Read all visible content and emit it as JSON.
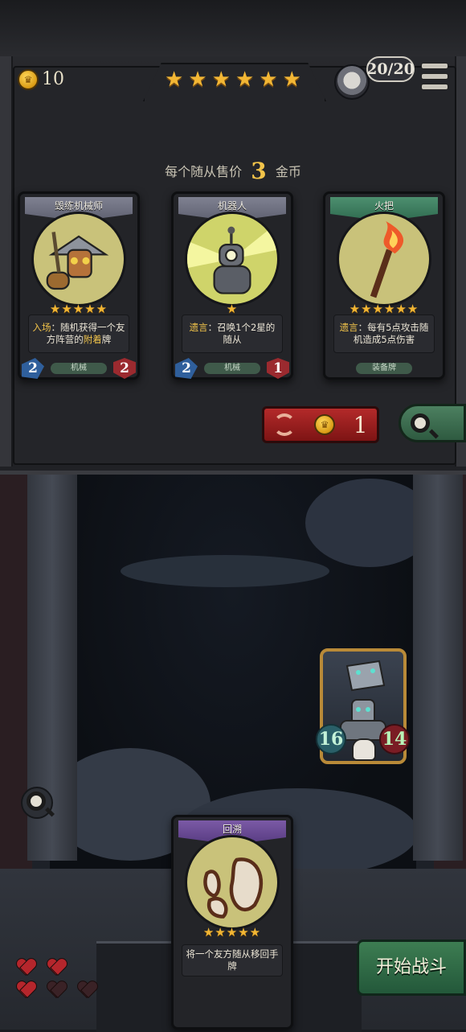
{
  "hud": {
    "gold": "10",
    "tier_stars": "★★★★★★",
    "player_health": "20/20"
  },
  "shop": {
    "price_prefix": "每个随从售价",
    "price_value": "3",
    "price_suffix": "金币",
    "refresh_cost": "1",
    "cards": [
      {
        "name": "毁练机械师",
        "stars": "★★★★★",
        "desc_kw": "入场",
        "desc_a": "：随机获得一个友方阵营的",
        "desc_kw2": "附着",
        "desc_b": "牌",
        "tribe": "机械",
        "attack": "2",
        "health": "2"
      },
      {
        "name": "机器人",
        "stars": "★",
        "desc_kw": "遗言",
        "desc_a": "：召唤1个2星的随从",
        "tribe": "机械",
        "attack": "2",
        "health": "1"
      },
      {
        "name": "火把",
        "stars": "★★★★★★",
        "desc_kw": "遗言",
        "desc_a": "：每有5点攻击随机造成5点伤害",
        "tribe": "装备牌"
      }
    ]
  },
  "battle": {
    "enemy": {
      "attack": "16",
      "health": "14"
    },
    "hand_card": {
      "name": "回溯",
      "stars": "★★★★★",
      "desc": "将一个友方随从移回手牌"
    },
    "start_button": "开始战斗",
    "lives": {
      "full": 3,
      "total": 5
    }
  },
  "colors": {
    "gold": "#f2b634",
    "keyword": "#f2c44a",
    "refresh": "#b42a2a",
    "start": "#3d7d52"
  },
  "icons": [
    "gold-coin-icon",
    "star-icon",
    "menu-icon",
    "refresh-icon",
    "search-icon",
    "heart-icon",
    "skull-icon"
  ]
}
